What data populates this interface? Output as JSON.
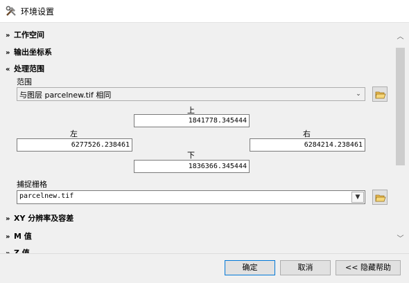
{
  "window": {
    "title": "环境设置"
  },
  "sections": {
    "workspace": "工作空间",
    "output_coords": "输出坐标系",
    "processing_extent": "处理范围",
    "xy_resolution": "XY 分辨率及容差",
    "m_values": "M 值",
    "z_values": "Z 值"
  },
  "extent": {
    "label": "范围",
    "value": "与图层 parcelnew.tif 相同",
    "top_label": "上",
    "top": "1841778.345444",
    "left_label": "左",
    "left": "6277526.238461",
    "right_label": "右",
    "right": "6284214.238461",
    "bottom_label": "下",
    "bottom": "1836366.345444"
  },
  "snap": {
    "label": "捕捉栅格",
    "value": "parcelnew.tif"
  },
  "buttons": {
    "ok": "确定",
    "cancel": "取消",
    "hide_help": "<< 隐藏帮助"
  },
  "icons": {
    "title": "tools-icon",
    "browse": "folder-open-icon",
    "expand": "chevron-double-down-icon",
    "collapse": "chevron-double-up-icon"
  }
}
